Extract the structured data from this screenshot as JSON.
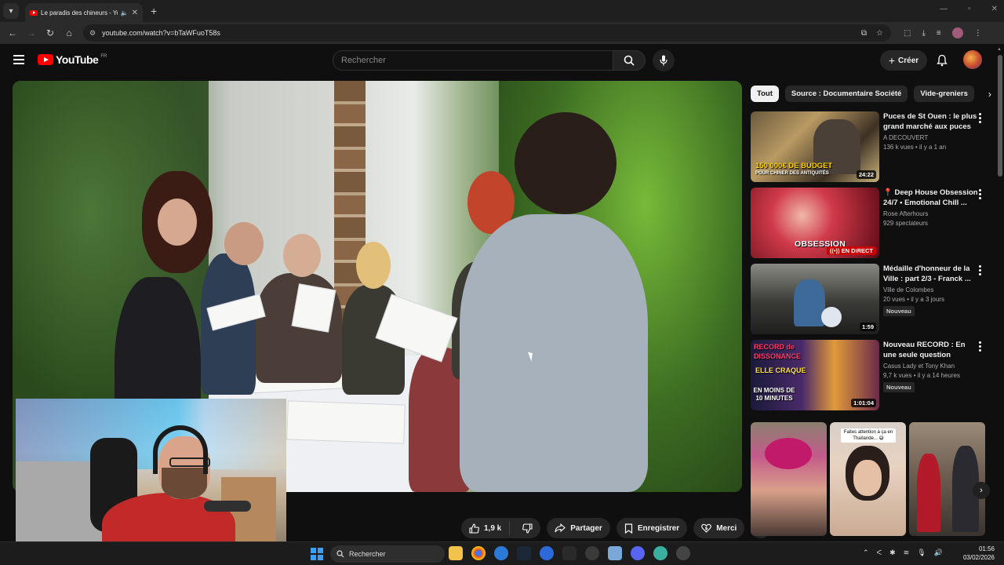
{
  "browser": {
    "tab_title": "Le paradis des chineurs - Yo",
    "url": "youtube.com/watch?v=bTaWFuoT58s"
  },
  "header": {
    "logo_text": "YouTube",
    "country_code": "FR",
    "search_placeholder": "Rechercher",
    "create_label": "Créer"
  },
  "actions": {
    "like_count": "1,9 k",
    "share_label": "Partager",
    "save_label": "Enregistrer",
    "thanks_label": "Merci"
  },
  "chips": [
    "Tout",
    "Source : Documentaire Société",
    "Vide-greniers"
  ],
  "recommendations": [
    {
      "title": "Puces de St Ouen : le plus grand marché aux puces ...",
      "channel": "A DECOUVERT",
      "meta": "136 k vues • il y a 1 an",
      "duration": "24:22",
      "overlay_line1": "150 000€ DE BUDGET",
      "overlay_line2": "POUR CHINER DES ANTIQUITÉS"
    },
    {
      "title": "Deep House Obsession 24/7 • Emotional Chill ...",
      "channel": "Rose Afterhours",
      "meta": "929 spectateurs",
      "live_label": "EN DIRECT",
      "overlay_line1": "OBSESSION"
    },
    {
      "title": "Médaille d'honneur de la Ville : part 2/3 - Franck ...",
      "channel": "Ville de Colombes",
      "meta": "20 vues • il y a 3 jours",
      "badge": "Nouveau",
      "duration": "1:59"
    },
    {
      "title": "Nouveau RECORD : En une seule question LOGIQUE ...",
      "channel": "Casus Lady et Tony Khan",
      "meta": "9,7 k vues • il y a 14 heures",
      "badge": "Nouveau",
      "duration": "1:01:04",
      "overlay_line1": "RECORD de",
      "overlay_line2": "DISSONANCE",
      "overlay_line3": "ELLE CRAQUE",
      "overlay_line4": "EN MOINS DE 10 MINUTES"
    }
  ],
  "shorts": [
    {
      "caption": ""
    },
    {
      "caption": "Faites attention à ça en Thaïlande... 😅"
    },
    {
      "caption": ""
    }
  ],
  "taskbar": {
    "search_label": "Rechercher",
    "time": "01:56",
    "date": "03/02/2026"
  }
}
